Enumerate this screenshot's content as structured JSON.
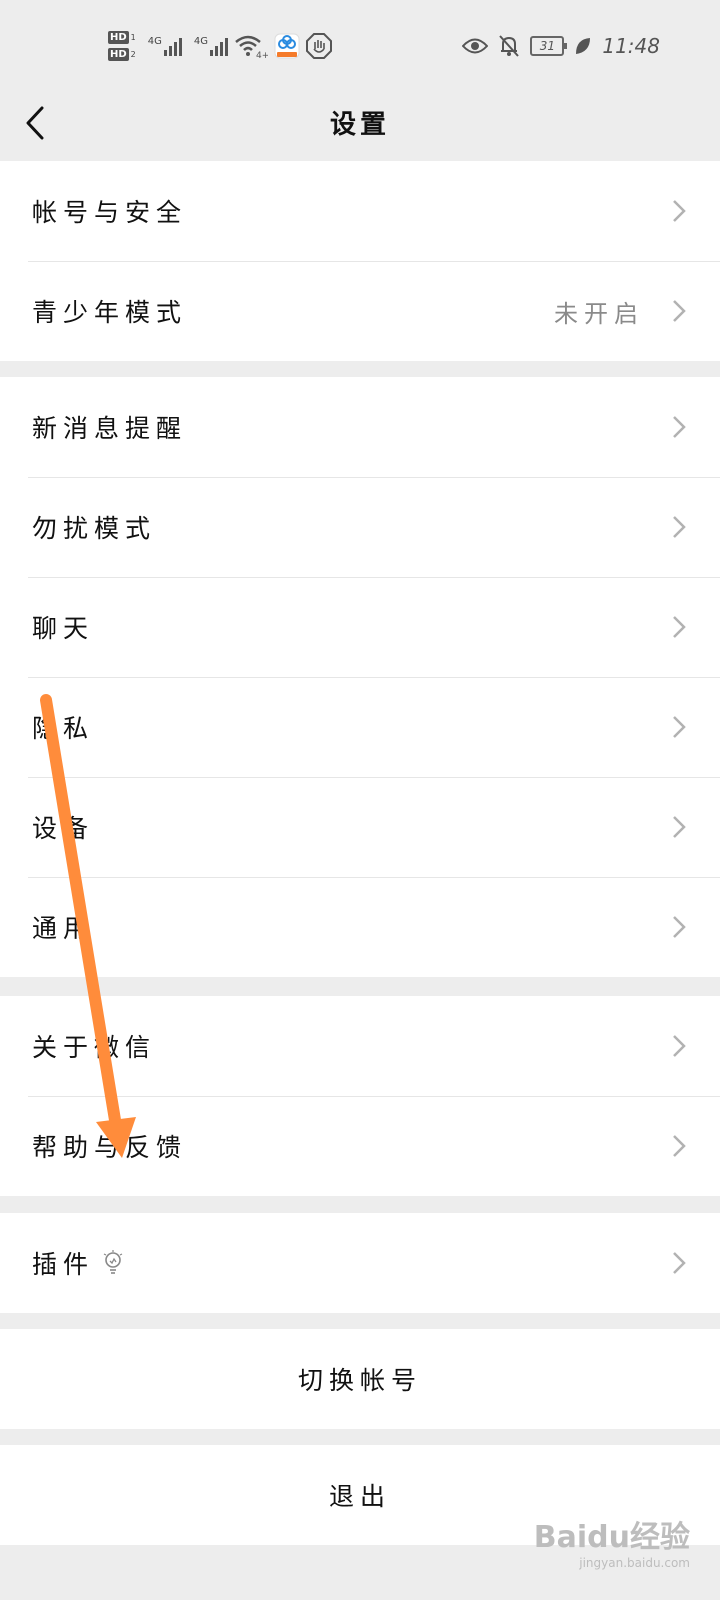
{
  "status_bar": {
    "hd1": "HD",
    "hd1_num": "1",
    "hd2": "HD",
    "hd2_num": "2",
    "net1": "4G",
    "net2": "4G",
    "wifi_label": "4+",
    "battery": "31",
    "time": "11:48",
    "icons": [
      "wifi-icon",
      "app-icon",
      "hand-icon",
      "eye-icon",
      "bell-off-icon",
      "leaf-icon"
    ]
  },
  "header": {
    "title": "设置"
  },
  "groups": [
    {
      "rows": [
        {
          "label": "帐号与安全"
        },
        {
          "label": "青少年模式",
          "value": "未开启"
        }
      ]
    },
    {
      "rows": [
        {
          "label": "新消息提醒"
        },
        {
          "label": "勿扰模式"
        },
        {
          "label": "聊天"
        },
        {
          "label": "隐私"
        },
        {
          "label": "设备"
        },
        {
          "label": "通用"
        }
      ]
    },
    {
      "rows": [
        {
          "label": "关于微信"
        },
        {
          "label": "帮助与反馈"
        }
      ]
    },
    {
      "rows": [
        {
          "label": "插件"
        }
      ]
    }
  ],
  "actions": {
    "switch_account": "切换帐号",
    "logout": "退出"
  },
  "watermark": {
    "brand": "Baidu经验",
    "site": "jingyan.baidu.com"
  },
  "colors": {
    "background": "#ededed",
    "card": "#ffffff",
    "annotation_arrow": "#ff8c3b",
    "secondary_text": "#8a8a8a"
  }
}
